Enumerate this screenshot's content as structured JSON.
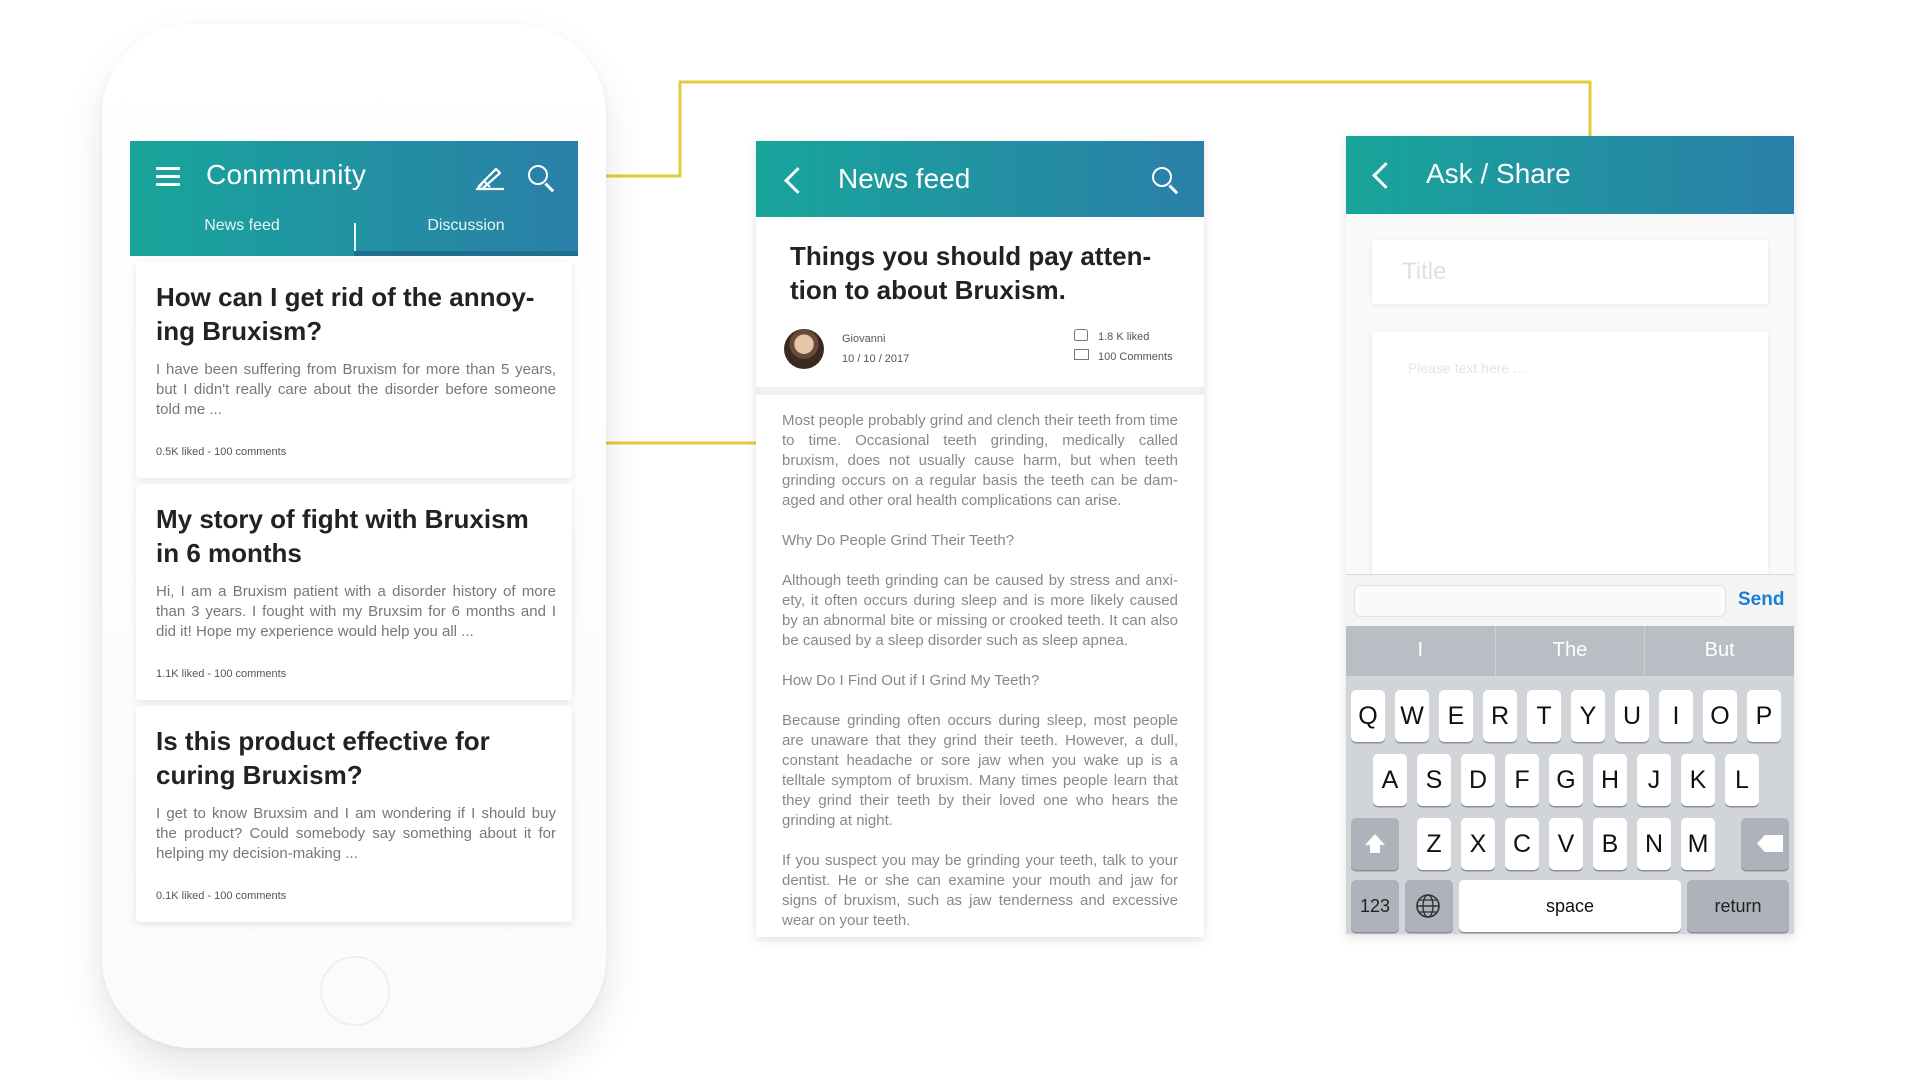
{
  "colors": {
    "teal_start": "#18a59b",
    "teal_end": "#2a7fa8",
    "connector": "#e3cc3b",
    "send": "#1a7ed8"
  },
  "community": {
    "title": "Conmmunity",
    "tabs": [
      "News feed",
      "Discussion"
    ],
    "posts": [
      {
        "title": "How can I get rid of the annoy- ing Bruxism?",
        "excerpt": "I have been suffering from Bruxism for more than 5 years, but I didn't really care about the disorder before someone told me ...",
        "meta": "0.5K liked - 100 comments"
      },
      {
        "title": "My story of fight with Bruxism in 6 months",
        "excerpt": "Hi, I am a Bruxism patient with a disorder history of more than 3 years. I fought with my Bruxsim for 6 months and I did it! Hope my experience would help you all ...",
        "meta": "1.1K liked - 100 comments"
      },
      {
        "title": "Is this product effective for curing Bruxism?",
        "excerpt": "I get to know Bruxsim and I am wondering if I should buy the product? Could somebody say something about it for helping my decision-making ...",
        "meta": "0.1K liked - 100 comments"
      }
    ]
  },
  "newsfeed": {
    "title": "News feed",
    "headline": "Things you should pay atten- tion to about Bruxism.",
    "author": "Giovanni",
    "date": "10 / 10 / 2017",
    "likes": "1.8 K liked",
    "comments": "100 Comments",
    "paragraphs": [
      "Most people probably grind and clench their teeth from time to time. Occasional teeth grinding, medically called bruxism, does not usually cause harm, but when teeth grinding occurs on a regular basis the teeth can be dam- aged and other oral health complications can arise.",
      "Why Do People Grind Their Teeth?",
      "Although teeth grinding can be caused by stress and anxi- ety, it often occurs during sleep and is more likely caused by an abnormal bite or missing or crooked teeth. It can also be caused by a sleep disorder such as sleep apnea.",
      "How Do I Find Out if I Grind My Teeth?",
      "Because grinding often occurs during sleep, most people are unaware that they grind their teeth. However, a dull, constant headache or sore jaw when you wake up is a telltale symptom of bruxism. Many times people learn that they grind their teeth by their loved one who hears the grinding at night.",
      "If you suspect you may be grinding your teeth, talk to your dentist. He or she can examine your mouth and jaw for signs of bruxism, such as jaw tenderness and excessive wear on your teeth."
    ]
  },
  "ask": {
    "title": "Ask / Share",
    "title_placeholder": "Title",
    "body_placeholder": "Please text here ...",
    "send": "Send",
    "suggestions": [
      "I",
      "The",
      "But"
    ],
    "row1": [
      "Q",
      "W",
      "E",
      "R",
      "T",
      "Y",
      "U",
      "I",
      "O",
      "P"
    ],
    "row2": [
      "A",
      "S",
      "D",
      "F",
      "G",
      "H",
      "J",
      "K",
      "L"
    ],
    "row3": [
      "Z",
      "X",
      "C",
      "V",
      "B",
      "N",
      "M"
    ],
    "numbers_key": "123",
    "space_key": "space",
    "return_key": "return"
  }
}
